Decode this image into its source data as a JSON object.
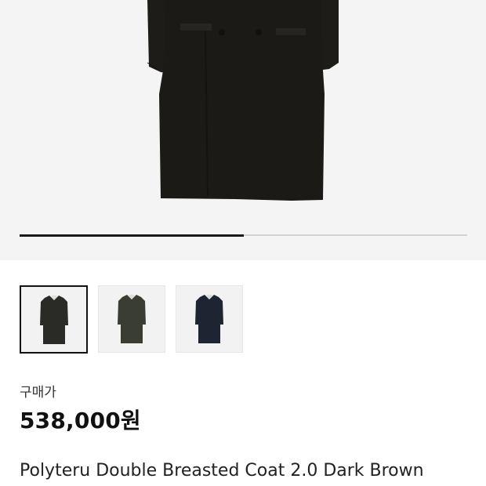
{
  "gallery": {
    "progress": 0.5,
    "thumbnails": [
      {
        "name": "thumb-coat-dark-brown",
        "color": "#2a2a26",
        "selected": true
      },
      {
        "name": "thumb-coat-olive",
        "color": "#3a3d33",
        "selected": false
      },
      {
        "name": "thumb-coat-navy",
        "color": "#1f2433",
        "selected": false
      }
    ]
  },
  "price_label": "구매가",
  "price": "538,000원",
  "product_title": "Polyteru Double Breasted Coat 2.0 Dark Brown",
  "colors": {
    "hero_bg": "#f4f4f4",
    "coat": "#1d1c19"
  }
}
